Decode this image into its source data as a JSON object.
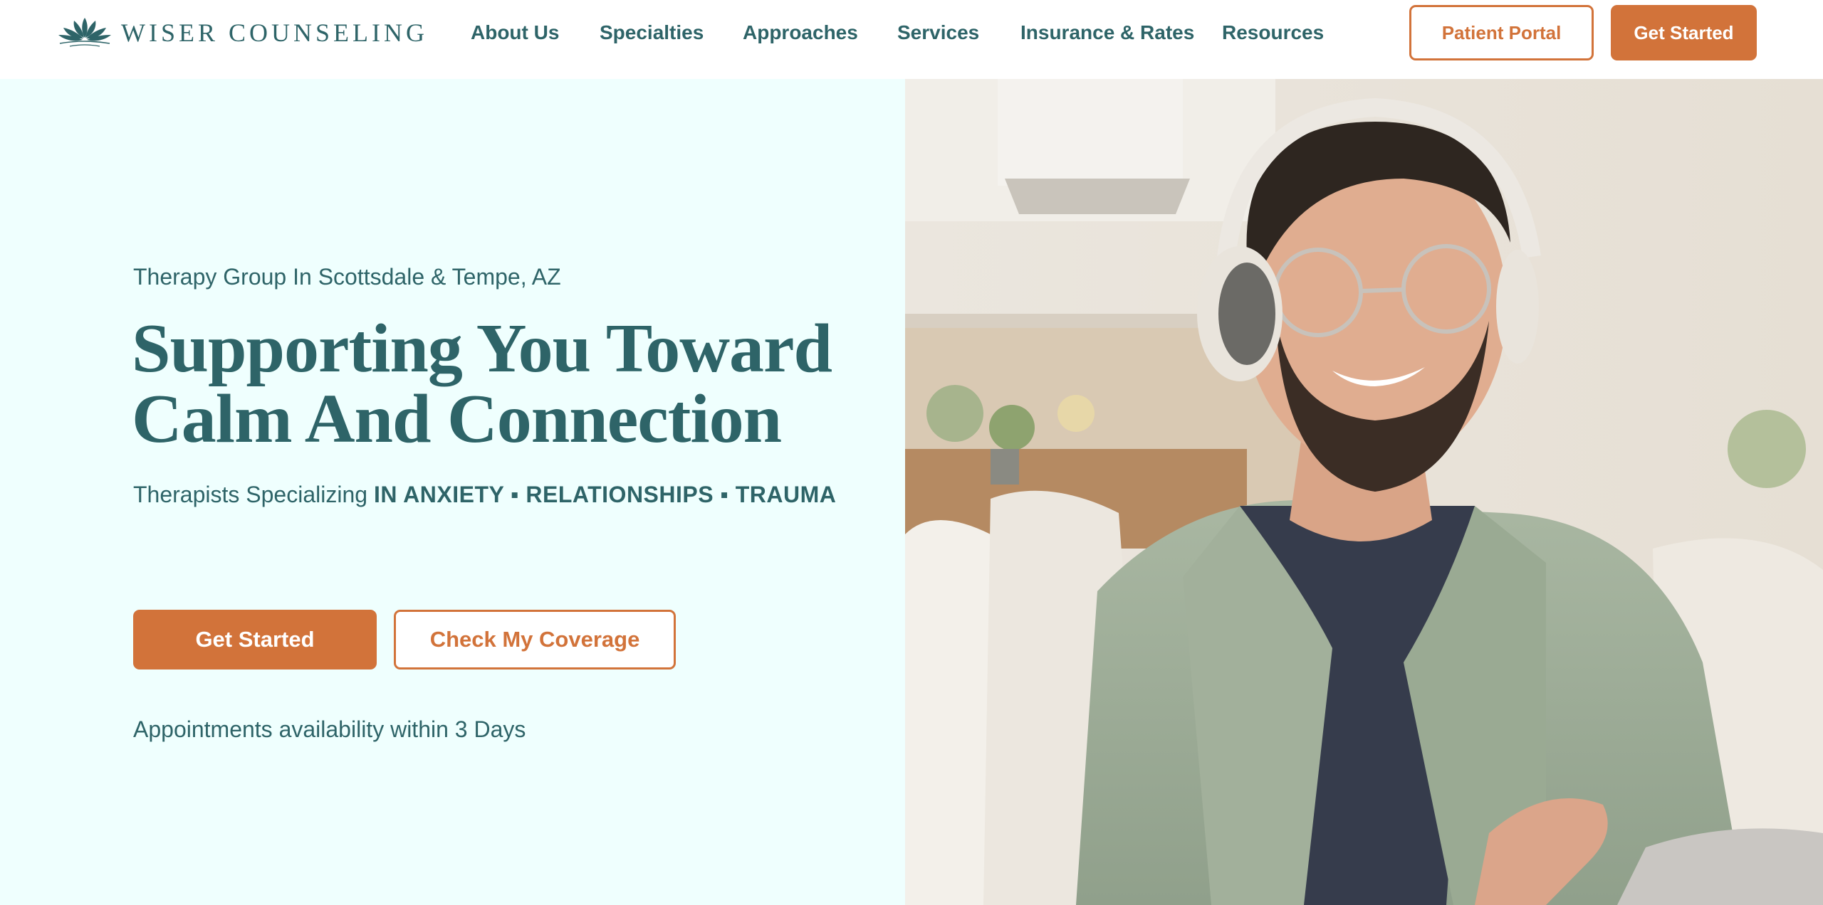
{
  "brand": {
    "name": "WISER COUNSELING",
    "logo_icon": "lotus-icon",
    "color_primary": "#2e6468",
    "color_accent": "#d2733a",
    "color_hero_bg": "#effffe"
  },
  "nav": {
    "items": [
      {
        "label": "About Us"
      },
      {
        "label": "Specialties"
      },
      {
        "label": "Approaches"
      },
      {
        "label": "Services"
      },
      {
        "label": "Insurance & Rates"
      },
      {
        "label": "Resources"
      }
    ],
    "patient_portal_label": "Patient Portal",
    "get_started_label": "Get Started"
  },
  "hero": {
    "eyebrow": "Therapy Group In Scottsdale & Tempe, AZ",
    "headline_line1": "Supporting You Toward",
    "headline_line2": "Calm And Connection",
    "specializing_prefix": "Therapists Specializing",
    "specializing_topics": "IN ANXIETY ▪ RELATIONSHIPS ▪ TRAUMA",
    "cta_primary": "Get Started",
    "cta_secondary": "Check My Coverage",
    "availability": "Appointments availability within 3 Days",
    "image_subject": "smiling man with headphones and glasses on a couch"
  }
}
